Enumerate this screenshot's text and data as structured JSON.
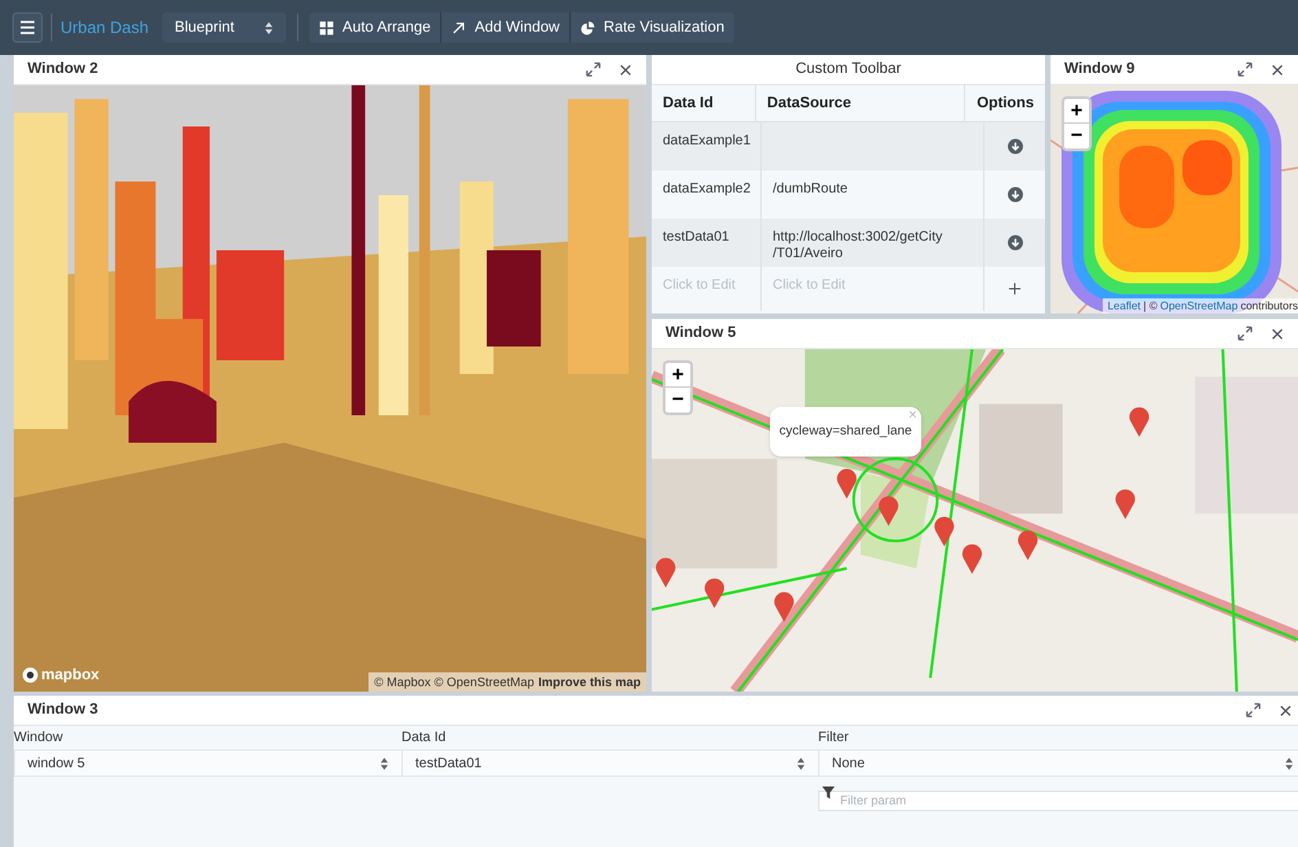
{
  "topbar": {
    "logo": "Urban Dash",
    "select": "Blueprint",
    "buttons": [
      {
        "kind": "grid",
        "label": "Auto Arrange"
      },
      {
        "kind": "arrow",
        "label": "Add Window"
      },
      {
        "kind": "pie",
        "label": "Rate Visualization"
      }
    ]
  },
  "window_2": {
    "title": "Window 2",
    "logo": "mapbox",
    "attribution": "© Mapbox © OpenStreetMap",
    "attribution_link": "Improve this map"
  },
  "custom_toolbar": {
    "title": "Custom Toolbar",
    "columns": [
      "Data Id",
      "DataSource",
      "Options"
    ],
    "rows": [
      {
        "kind": "data",
        "data_id": "dataExample1"
      },
      {
        "kind": "data",
        "data_id": "dataExample2",
        "data_source": "/dumbRoute"
      },
      {
        "kind": "data",
        "data_id": "testData01",
        "data_source": "http://localhost:3002/getCity /T01/Aveiro"
      },
      {
        "kind": "new",
        "data_id": "Click to Edit",
        "data_source": "Click to Edit"
      }
    ]
  },
  "window_9": {
    "title": "Window 9",
    "zoom_in": "+",
    "zoom_out": "−",
    "attribution_link_1": "Leaflet",
    "attribution": "| ©",
    "attribution_link_2": "OpenStreetMap",
    "attribution_end": "contributors"
  },
  "window_5": {
    "title": "Window 5",
    "zoom_in": "+",
    "zoom_out": "−",
    "popup": {
      "text": "cycleway=shared_lane",
      "close": "×"
    }
  },
  "window_3": {
    "title": "Window 3",
    "fields": [
      {
        "label": "Window",
        "value": "window 5"
      },
      {
        "label": "Data Id",
        "value": "testData01"
      },
      {
        "label": "Filter",
        "value": "None"
      }
    ],
    "filter_param": {
      "placeholder": "Filter param"
    }
  }
}
